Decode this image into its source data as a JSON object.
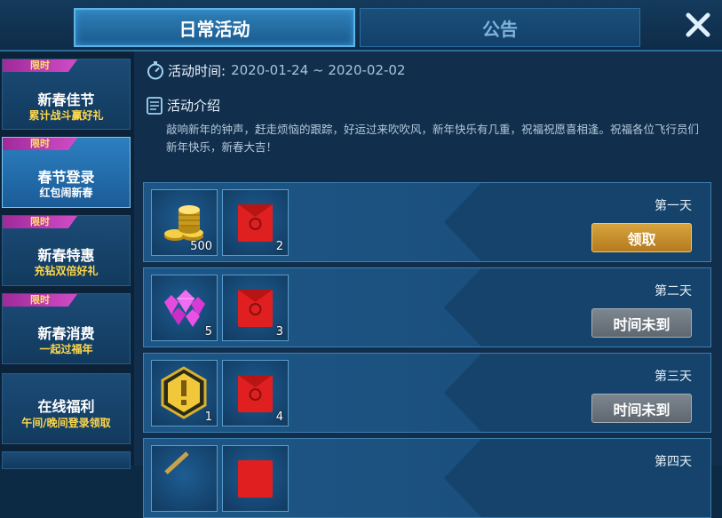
{
  "tabs": {
    "daily": "日常活动",
    "notice": "公告"
  },
  "sidebar": {
    "badge": "限时",
    "items": [
      {
        "title": "新春佳节",
        "subtitle": "累计战斗赢好礼",
        "limited": true
      },
      {
        "title": "春节登录",
        "subtitle": "红包闹新春",
        "limited": true
      },
      {
        "title": "新春特惠",
        "subtitle": "充钻双倍好礼",
        "limited": true
      },
      {
        "title": "新春消费",
        "subtitle": "一起过福年",
        "limited": true
      },
      {
        "title": "在线福利",
        "subtitle": "午间/晚间登录领取",
        "limited": false
      }
    ]
  },
  "activity": {
    "time_label": "活动时间:",
    "time_value": "2020-01-24 ~ 2020-02-02",
    "intro_label": "活动介绍",
    "intro_text": "敲响新年的钟声，赶走烦恼的跟踪，好运过来吹吹风，新年快乐有几重，祝福祝愿喜相逢。祝福各位飞行员们新年快乐，新春大吉！"
  },
  "days": [
    {
      "label": "第一天",
      "button": "领取",
      "button_state": "claim",
      "items": [
        {
          "icon": "gold-coins-icon",
          "count": "500"
        },
        {
          "icon": "red-envelope-icon",
          "count": "2"
        }
      ]
    },
    {
      "label": "第二天",
      "button": "时间未到",
      "button_state": "wait",
      "items": [
        {
          "icon": "diamonds-icon",
          "count": "5"
        },
        {
          "icon": "red-envelope-icon",
          "count": "3"
        }
      ]
    },
    {
      "label": "第三天",
      "button": "时间未到",
      "button_state": "wait",
      "items": [
        {
          "icon": "gold-medal-icon",
          "count": "1"
        },
        {
          "icon": "red-envelope-icon",
          "count": "4"
        }
      ]
    },
    {
      "label": "第四天",
      "button": "",
      "button_state": "wait",
      "items": [
        {
          "icon": "sword-icon",
          "count": ""
        },
        {
          "icon": "red-envelope-icon",
          "count": ""
        }
      ]
    }
  ],
  "colors": {
    "claim": "#c88f2d",
    "wait": "#6c757d",
    "accent": "#5eb4e6",
    "badge": "#c03fb8"
  }
}
